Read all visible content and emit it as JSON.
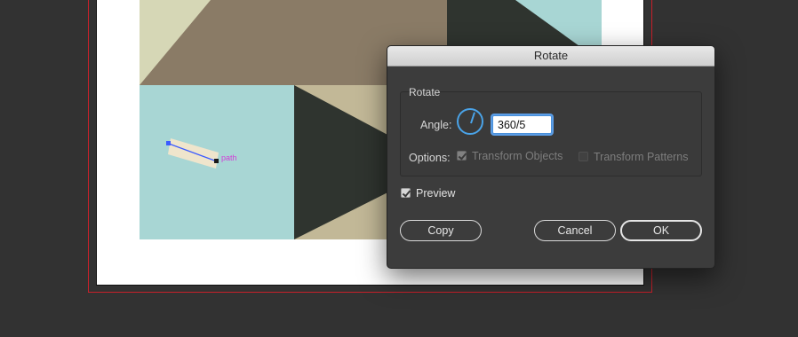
{
  "dialog": {
    "title": "Rotate",
    "group_title": "Rotate",
    "angle_label": "Angle:",
    "angle_value": "360/5",
    "options_label": "Options:",
    "transform_objects_label": "Transform Objects",
    "transform_patterns_label": "Transform Patterns",
    "preview_label": "Preview",
    "copy_button": "Copy",
    "cancel_button": "Cancel",
    "ok_button": "OK",
    "transform_objects_checked": true,
    "transform_objects_enabled": false,
    "transform_patterns_checked": false,
    "transform_patterns_enabled": false,
    "preview_checked": true
  },
  "canvas": {
    "selection_label": "path"
  },
  "colors": {
    "background": "#323232",
    "dialog_bg": "#3c3c3c",
    "accent": "#4aa3e8",
    "bleed_guide": "#c8202a",
    "selection": "#3b5bff",
    "path_label": "#d23ed8",
    "art_khaki": "#d6d7b6",
    "art_taupe": "#8a7b66",
    "art_aqua": "#a8d6d4",
    "art_dark": "#2f342f",
    "art_tan": "#c2b897",
    "art_cream": "#efe5cc"
  }
}
